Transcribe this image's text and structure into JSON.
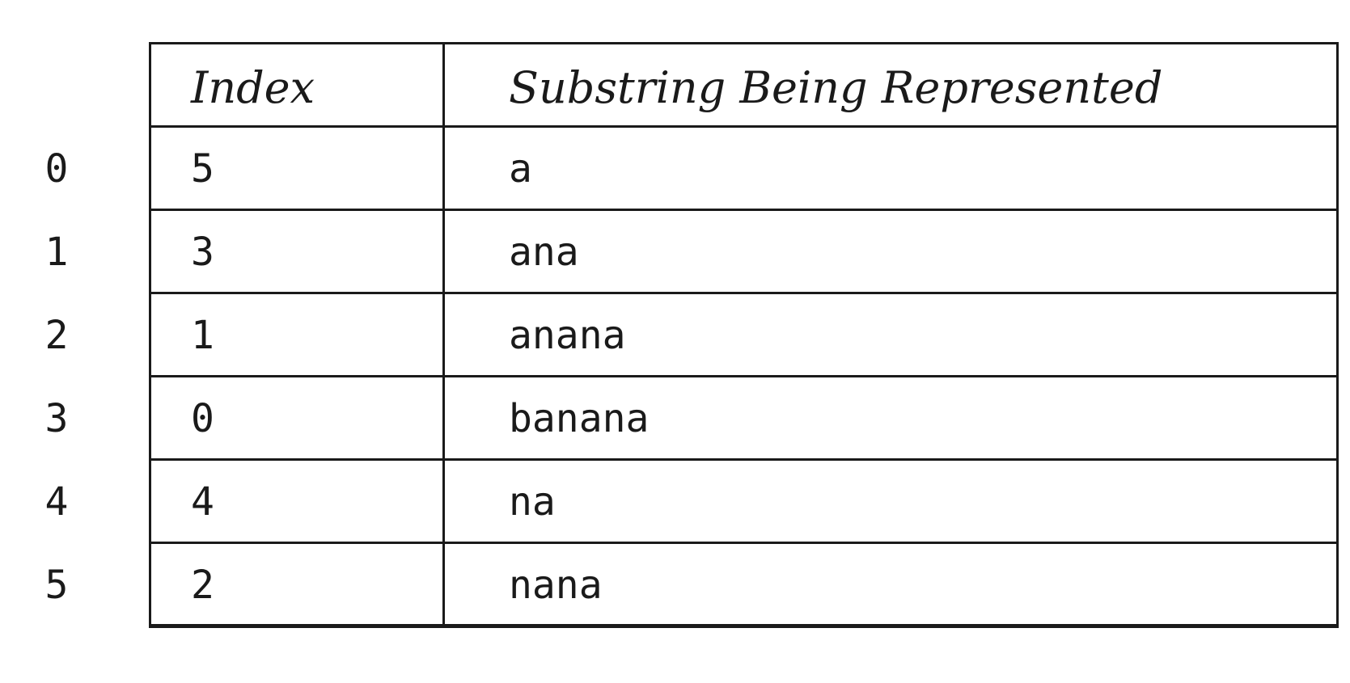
{
  "headers": {
    "index": "Index",
    "substring": "Substring Being Represented"
  },
  "rows": [
    {
      "position": "0",
      "index": "5",
      "substring": "a"
    },
    {
      "position": "1",
      "index": "3",
      "substring": "ana"
    },
    {
      "position": "2",
      "index": "1",
      "substring": "anana"
    },
    {
      "position": "3",
      "index": "0",
      "substring": "banana"
    },
    {
      "position": "4",
      "index": "4",
      "substring": "na"
    },
    {
      "position": "5",
      "index": "2",
      "substring": "nana"
    }
  ]
}
